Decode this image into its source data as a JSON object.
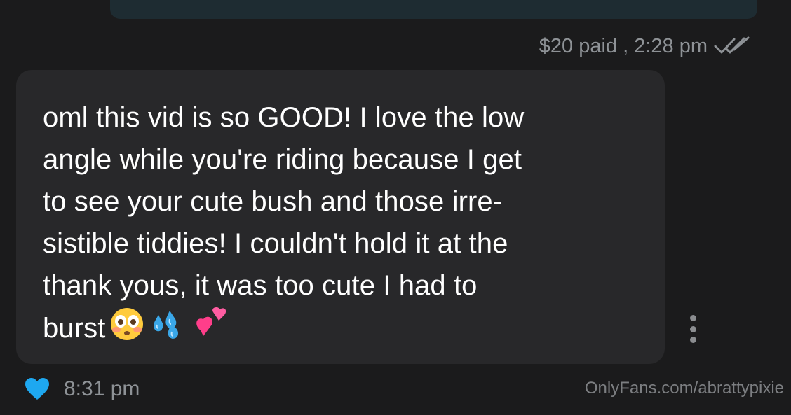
{
  "outgoing": {
    "meta_label": "$20 paid , 2:28 pm",
    "status_icon": "double-check-icon"
  },
  "incoming": {
    "message": "oml this vid is so GOOD! I love the low\nangle while you're riding because I get\nto see your cute bush and those irre-\nsistible tiddies! I couldn't hold it at the\nthank yous, it was too cute I had to\nburst",
    "emojis": [
      "flushed-face",
      "sweat-droplets",
      "two-hearts"
    ],
    "time": "8:31 pm",
    "liked": true,
    "menu_icon": "kebab-menu-icon"
  },
  "watermark": "OnlyFans.com/abrattypixie",
  "colors": {
    "background": "#1b1b1c",
    "incoming_bubble": "#28282a",
    "outgoing_bubble": "#1e2c32",
    "heart": "#1ea8f0",
    "meta_text": "#8e9296"
  }
}
